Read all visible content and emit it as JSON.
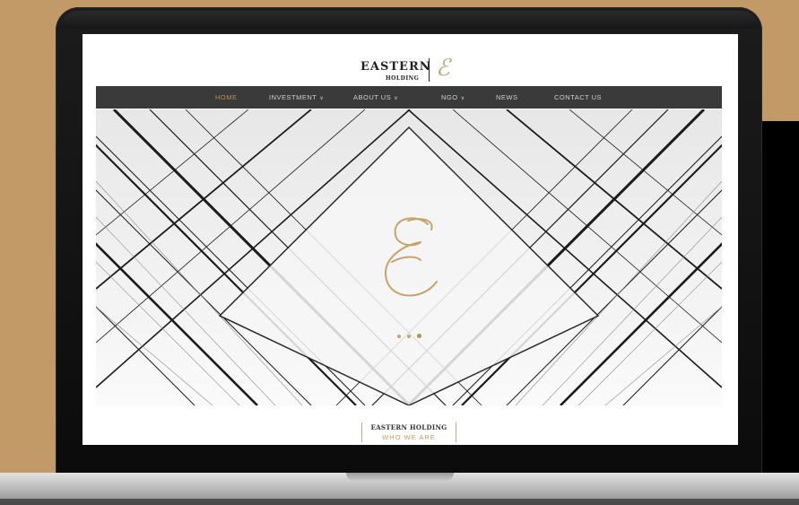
{
  "site": {
    "logo": {
      "line1": "EASTERN",
      "line2": "HOLDING",
      "mark": "ℰ"
    },
    "nav": [
      {
        "label": "HOME",
        "active": true,
        "has_dropdown": false
      },
      {
        "label": "INVESTMENT",
        "active": false,
        "has_dropdown": true
      },
      {
        "label": "ABOUT US",
        "active": false,
        "has_dropdown": true
      },
      {
        "label": "NGO",
        "active": false,
        "has_dropdown": true
      },
      {
        "label": "NEWS",
        "active": false,
        "has_dropdown": false
      },
      {
        "label": "CONTACT US",
        "active": false,
        "has_dropdown": false
      }
    ],
    "hero": {
      "slides": 3,
      "active_slide": 3
    },
    "section": {
      "title": "EASTERN HOLDING",
      "subtitle": "WHO WE ARE"
    },
    "colors": {
      "accent": "#b5944f",
      "nav_bg": "#3a3a3a",
      "backdrop": "#c29a68"
    }
  }
}
